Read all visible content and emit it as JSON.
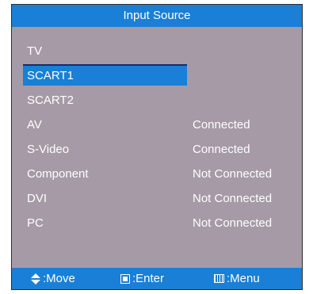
{
  "header": {
    "title": "Input Source"
  },
  "sources": [
    {
      "label": "TV",
      "status": "",
      "selected": false
    },
    {
      "label": "SCART1",
      "status": "",
      "selected": true
    },
    {
      "label": "SCART2",
      "status": "",
      "selected": false
    },
    {
      "label": "AV",
      "status": "Connected",
      "selected": false
    },
    {
      "label": "S-Video",
      "status": "Connected",
      "selected": false
    },
    {
      "label": "Component",
      "status": "Not Connected",
      "selected": false
    },
    {
      "label": "DVI",
      "status": "Not Connected",
      "selected": false
    },
    {
      "label": "PC",
      "status": "Not Connected",
      "selected": false
    }
  ],
  "footer": {
    "move_icon": "up-down-arrows-icon",
    "move_label": ":Move",
    "enter_icon": "enter-square-icon",
    "enter_label": ":Enter",
    "menu_icon": "menu-grid-icon",
    "menu_label": ":Menu"
  },
  "colors": {
    "bar": "#1a7fd6",
    "panel": "#a59aa5",
    "highlight_border": "#1c2a6a",
    "text": "#ffffff"
  }
}
